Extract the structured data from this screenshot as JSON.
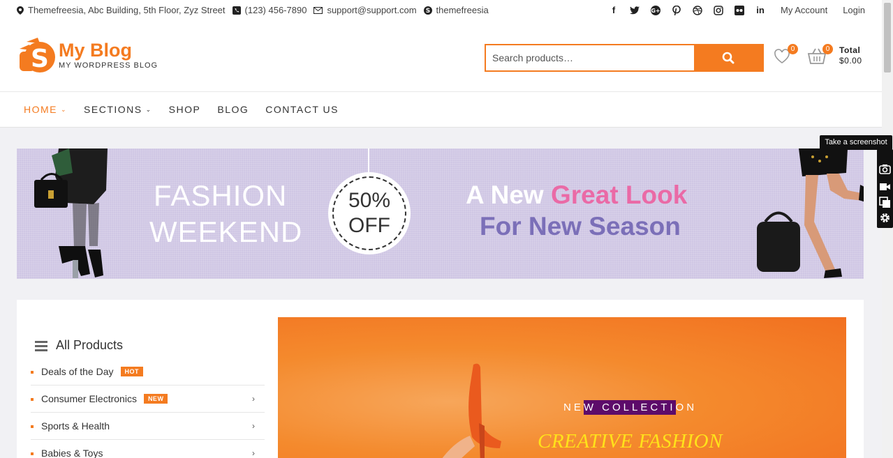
{
  "topbar": {
    "address": "Themefreesia, Abc Building, 5th Floor, Zyz Street",
    "phone": "(123) 456-7890",
    "email": "support@support.com",
    "skype": "themefreesia",
    "social_icons": [
      "facebook-icon",
      "twitter-icon",
      "google-plus-icon",
      "pinterest-icon",
      "dribbble-icon",
      "instagram-icon",
      "flickr-icon",
      "linkedin-icon"
    ],
    "my_account": "My Account",
    "login": "Login"
  },
  "header": {
    "logo_title": "My Blog",
    "logo_tagline": "MY WORDPRESS BLOG",
    "search_placeholder": "Search products…",
    "wishlist_count": "0",
    "cart_count": "0",
    "total_label": "Total",
    "total_value": "$0.00"
  },
  "nav": {
    "items": [
      {
        "label": "HOME",
        "dropdown": true,
        "active": true
      },
      {
        "label": "SECTIONS",
        "dropdown": true
      },
      {
        "label": "SHOP"
      },
      {
        "label": "BLOG"
      },
      {
        "label": "CONTACT US"
      }
    ]
  },
  "banner": {
    "line1": "FASHION",
    "line2": "WEEKEND",
    "discount_value": "50%",
    "discount_label": "OFF",
    "headline_part1": "A New",
    "headline_part2": "Great Look",
    "headline_line2": "For New Season"
  },
  "categories": {
    "title": "All Products",
    "items": [
      {
        "label": "Deals of the Day",
        "tag": "HOT"
      },
      {
        "label": "Consumer Electronics",
        "tag": "NEW",
        "submenu": true
      },
      {
        "label": "Sports & Health",
        "submenu": true
      },
      {
        "label": "Babies & Toys",
        "submenu": true
      }
    ]
  },
  "hero": {
    "kicker_a": "NE",
    "kicker_b": "W COLLECTI",
    "kicker_c": "ON",
    "title": "CREATIVE FASHION"
  },
  "screenshot_tool": {
    "tooltip": "Take a screenshot",
    "icons": [
      "camera-icon",
      "video-icon",
      "copy-icon",
      "settings-icon"
    ]
  },
  "colors": {
    "accent": "#f47b20",
    "banner_bg": "#cfc6e4",
    "pink": "#ea6aa6",
    "purple": "#7b6fb8",
    "highlight": "#5d0b6a",
    "hero_title": "#ffe21a"
  }
}
